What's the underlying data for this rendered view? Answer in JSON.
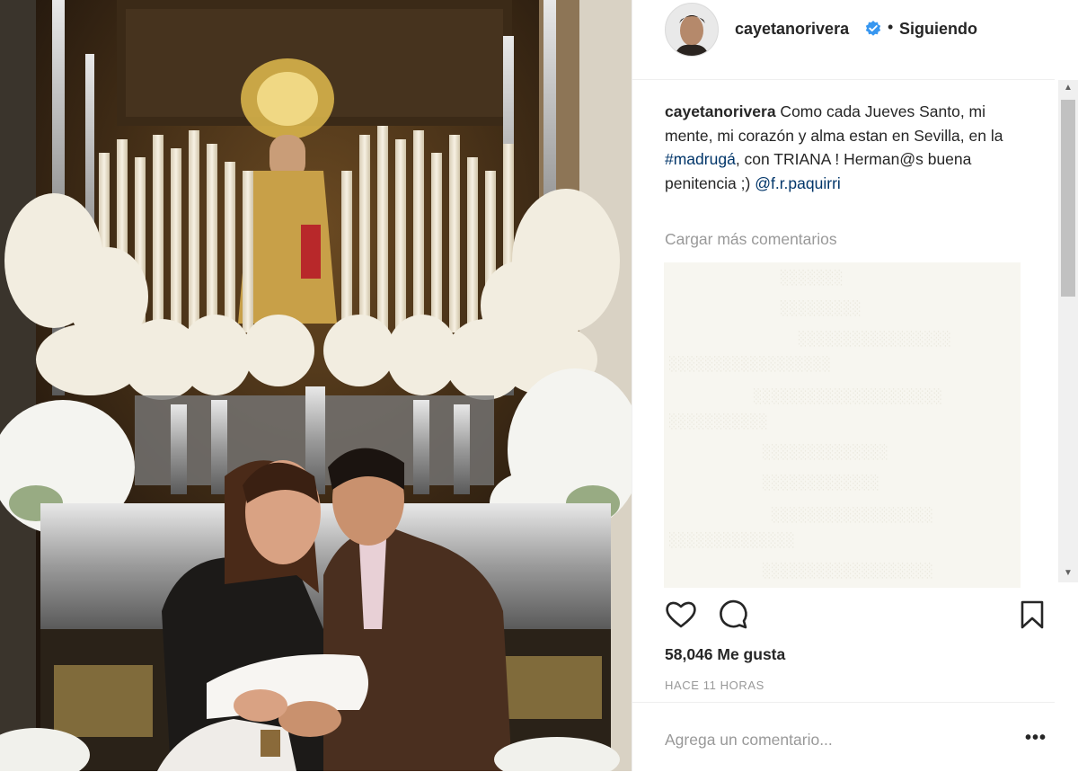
{
  "post": {
    "username": "cayetanorivera",
    "follow_status": "Siguiendo",
    "separator": "•",
    "caption": {
      "username": "cayetanorivera",
      "text_before_tag": " Como cada Jueves Santo, mi mente, mi corazón y alma estan en Sevilla, en la ",
      "hashtag": "#madrugá",
      "text_after_tag": ", con TRIANA ! Herman@s buena penitencia ;) ",
      "mention": "@f.r.paquirri"
    },
    "load_more": "Cargar más comentarios",
    "likes": "58,046 Me gusta",
    "timestamp": "HACE 11 HORAS",
    "comment_placeholder": "Agrega un comentario...",
    "more_options": "•••"
  },
  "icons": {
    "verified": "verified-badge-icon",
    "like": "heart-icon",
    "comment": "comment-bubble-icon",
    "save": "bookmark-icon",
    "more": "more-options-icon"
  },
  "colors": {
    "verified_blue": "#3897f0",
    "link": "#003569",
    "muted_text": "#999999",
    "primary_text": "#262626"
  }
}
